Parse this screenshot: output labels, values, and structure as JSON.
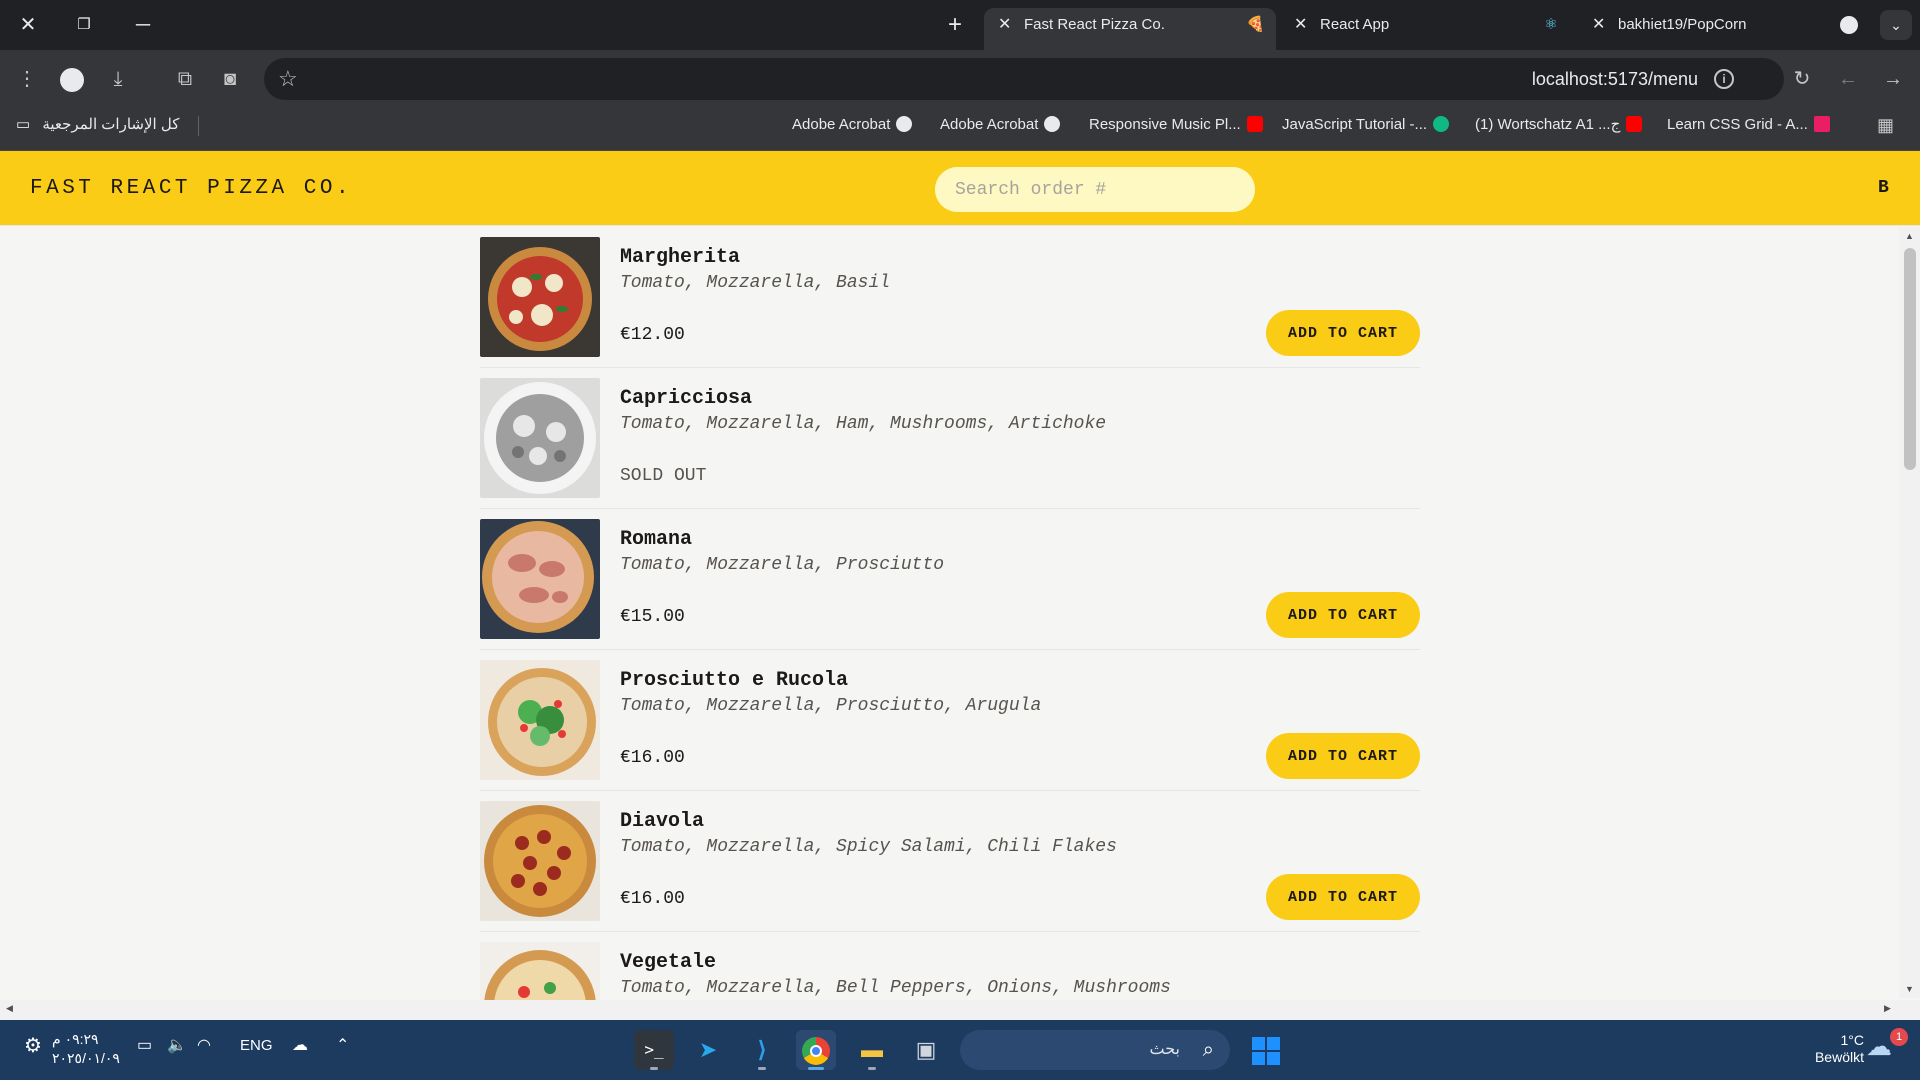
{
  "browser": {
    "tabs": [
      {
        "title": "Fast React Pizza Co.",
        "active": true
      },
      {
        "title": "React App",
        "active": false
      },
      {
        "title": "bakhiet19/PopCorn",
        "active": false
      }
    ],
    "url": "localhost:5173/menu",
    "bookmarks_all_label": "كل الإشارات المرجعية",
    "bookmarks": [
      {
        "label": "Adobe Acrobat",
        "icon_color": "#e8eaed"
      },
      {
        "label": "Adobe Acrobat",
        "icon_color": "#e8eaed"
      },
      {
        "label": "Responsive Music Pl...",
        "icon_color": "#ff0000"
      },
      {
        "label": "JavaScript Tutorial -...",
        "icon_color": "#10b981"
      },
      {
        "label": "(1) Wortschatz A1 ...ج",
        "icon_color": "#ff0000"
      },
      {
        "label": "Learn CSS Grid - A...",
        "icon_color": "#e91e63"
      }
    ]
  },
  "app": {
    "logo": "FAST REACT PIZZA CO.",
    "search_placeholder": "Search order #",
    "username_initial": "B",
    "add_to_cart_label": "ADD TO CART",
    "sold_out_label": "SOLD OUT"
  },
  "menu": [
    {
      "name": "Margherita",
      "ingredients": "Tomato, Mozzarella, Basil",
      "price": "€12.00",
      "sold_out": false
    },
    {
      "name": "Capricciosa",
      "ingredients": "Tomato, Mozzarella, Ham, Mushrooms, Artichoke",
      "price": "",
      "sold_out": true
    },
    {
      "name": "Romana",
      "ingredients": "Tomato, Mozzarella, Prosciutto",
      "price": "€15.00",
      "sold_out": false
    },
    {
      "name": "Prosciutto e Rucola",
      "ingredients": "Tomato, Mozzarella, Prosciutto, Arugula",
      "price": "€16.00",
      "sold_out": false
    },
    {
      "name": "Diavola",
      "ingredients": "Tomato, Mozzarella, Spicy Salami, Chili Flakes",
      "price": "€16.00",
      "sold_out": false
    },
    {
      "name": "Vegetale",
      "ingredients": "Tomato, Mozzarella, Bell Peppers, Onions, Mushrooms",
      "price": "",
      "sold_out": false
    }
  ],
  "taskbar": {
    "time": "٠٩:٢٩ م",
    "date": "٢٠٢٥/٠١/٠٩",
    "language": "ENG",
    "search_placeholder": "بحث",
    "weather_temp": "1°C",
    "weather_desc": "Bewölkt",
    "notification_count": "1"
  },
  "colors": {
    "accent_yellow": "#facc15",
    "search_bg": "#fef9c3",
    "page_bg": "#f5f5f4"
  }
}
